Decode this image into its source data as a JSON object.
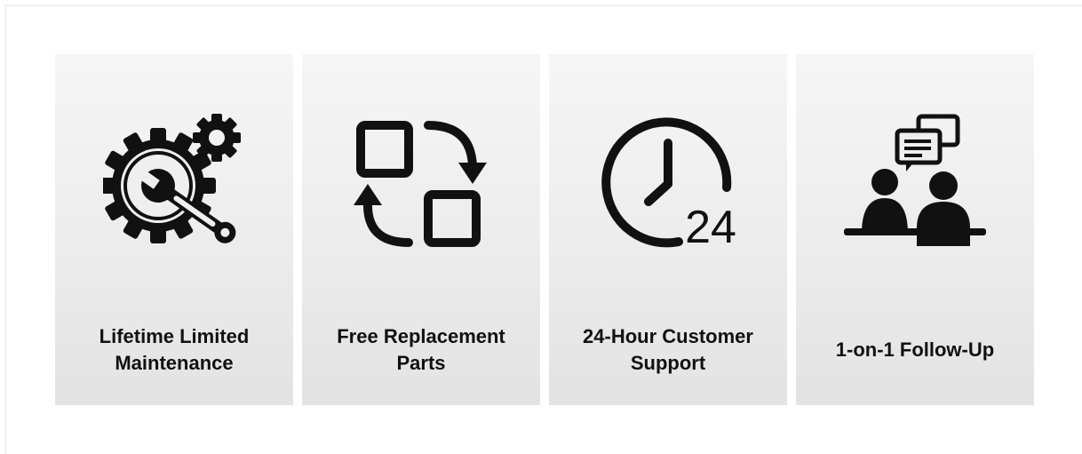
{
  "colors": {
    "icon": "#111111",
    "text": "#111111",
    "card_top": "#f6f6f6",
    "card_bottom": "#e3e3e3",
    "page_bg": "#ffffff"
  },
  "features": [
    {
      "icon": "gear-wrench-icon",
      "label": "Lifetime Limited Maintenance"
    },
    {
      "icon": "swap-arrows-icon",
      "label": "Free Replacement Parts"
    },
    {
      "icon": "clock-24-icon",
      "label": "24-Hour Customer Support"
    },
    {
      "icon": "consultation-icon",
      "label": "1-on-1 Follow-Up"
    }
  ],
  "clock_text": "24"
}
